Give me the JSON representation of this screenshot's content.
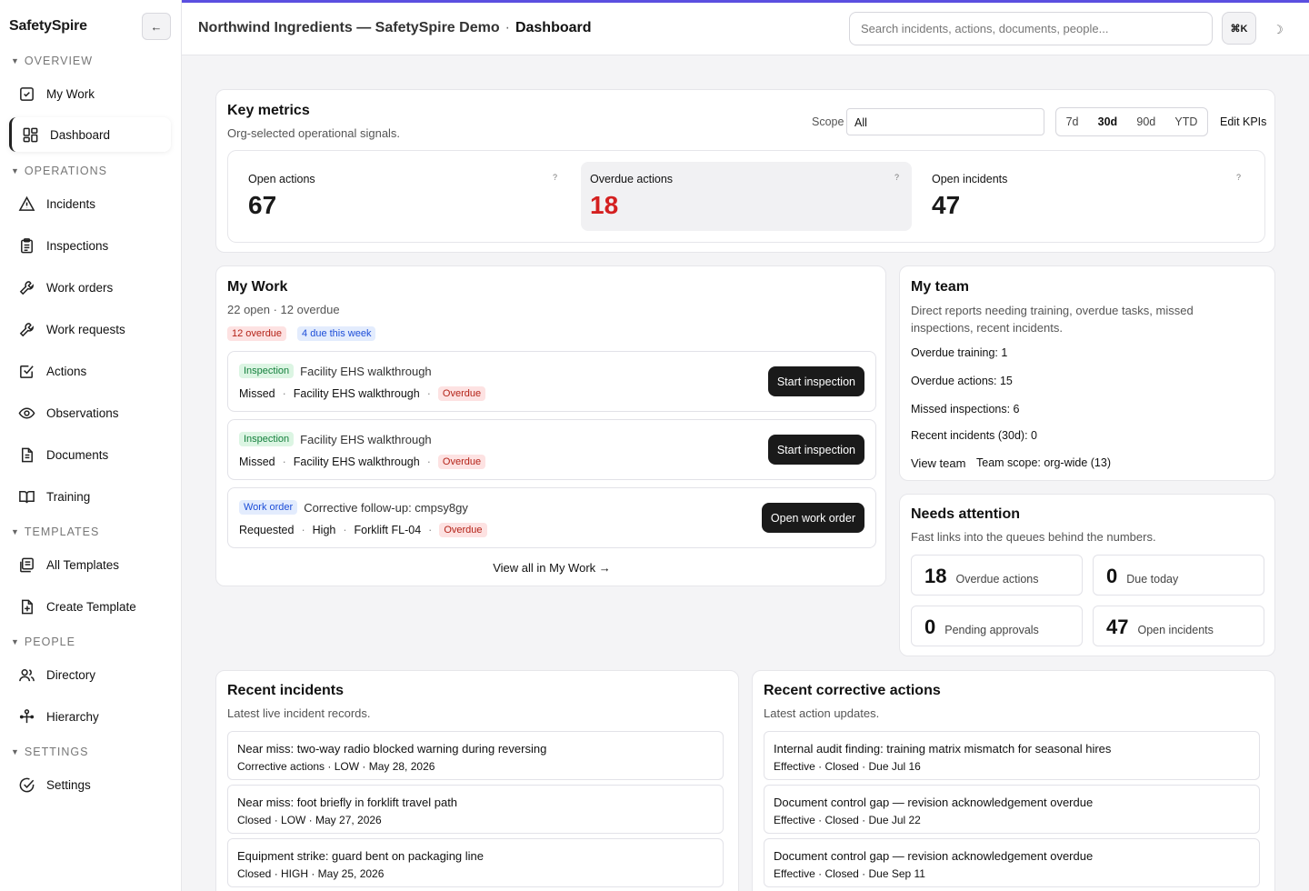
{
  "sidebar": {
    "brand": "SafetySpire",
    "collapse_icon": "←",
    "sections": [
      {
        "label": "OVERVIEW"
      },
      {
        "label": "OPERATIONS"
      },
      {
        "label": "TEMPLATES"
      },
      {
        "label": "PEOPLE"
      },
      {
        "label": "SETTINGS"
      }
    ],
    "items": [
      {
        "label": "My Work",
        "icon": "checkbox-icon"
      },
      {
        "label": "Dashboard",
        "icon": "grid-icon"
      },
      {
        "label": "Incidents",
        "icon": "warning-icon"
      },
      {
        "label": "Inspections",
        "icon": "clipboard-icon"
      },
      {
        "label": "Work orders",
        "icon": "wrench-icon"
      },
      {
        "label": "Work requests",
        "icon": "wrench-icon"
      },
      {
        "label": "Actions",
        "icon": "checkbox-icon"
      },
      {
        "label": "Observations",
        "icon": "eye-icon"
      },
      {
        "label": "Documents",
        "icon": "document-icon"
      },
      {
        "label": "Training",
        "icon": "book-icon"
      },
      {
        "label": "All Templates",
        "icon": "templates-icon"
      },
      {
        "label": "Create Template",
        "icon": "file-plus-icon"
      },
      {
        "label": "Directory",
        "icon": "users-icon"
      },
      {
        "label": "Hierarchy",
        "icon": "hierarchy-icon"
      },
      {
        "label": "Settings",
        "icon": "check-circle-icon"
      }
    ]
  },
  "header": {
    "org": "Northwind Ingredients — SafetySpire Demo",
    "separator": "·",
    "page": "Dashboard",
    "search_placeholder": "Search incidents, actions, documents, people...",
    "shortcut": "⌘K",
    "theme_icon": "☽"
  },
  "key_metrics": {
    "title": "Key metrics",
    "subtitle": "Org-selected operational signals.",
    "scope_label": "Scope",
    "scope_value": "All",
    "ranges": [
      "7d",
      "30d",
      "90d",
      "YTD"
    ],
    "selected_range": "30d",
    "edit_label": "Edit KPIs",
    "metrics": [
      {
        "label": "Open actions",
        "value": "67",
        "help": "?"
      },
      {
        "label": "Overdue actions",
        "value": "18",
        "help": "?"
      },
      {
        "label": "Open incidents",
        "value": "47",
        "help": "?"
      }
    ],
    "overdue_color": "#d42020"
  },
  "my_work": {
    "title": "My Work",
    "summary": "22 open · 12 overdue",
    "badges": [
      "12 overdue",
      "4 due this week"
    ],
    "items": [
      {
        "type": "Inspection",
        "title": "Facility EHS walkthrough",
        "meta": [
          "Missed",
          "Facility EHS walkthrough"
        ],
        "status": "Overdue",
        "button": "Start inspection"
      },
      {
        "type": "Inspection",
        "title": "Facility EHS walkthrough",
        "meta": [
          "Missed",
          "Facility EHS walkthrough"
        ],
        "status": "Overdue",
        "button": "Start inspection"
      },
      {
        "type": "Work order",
        "title": "Corrective follow-up: cmpsy8gy",
        "meta": [
          "Requested",
          "High",
          "Forklift FL-04"
        ],
        "status": "Overdue",
        "button": "Open work order"
      }
    ],
    "view_all": "View all in My Work →"
  },
  "my_team": {
    "title": "My team",
    "subtitle": "Direct reports needing training, overdue tasks, missed inspections, recent incidents.",
    "lines": [
      "Overdue training: 1",
      "Overdue actions: 15",
      "Missed inspections: 6",
      "Recent incidents (30d): 0"
    ],
    "view_team": "View team",
    "scope": "Team scope: org-wide (13)"
  },
  "needs_attention": {
    "title": "Needs attention",
    "subtitle": "Fast links into the queues behind the numbers.",
    "boxes": [
      {
        "n": "18",
        "t": "Overdue actions"
      },
      {
        "n": "0",
        "t": "Due today"
      },
      {
        "n": "0",
        "t": "Pending approvals"
      },
      {
        "n": "47",
        "t": "Open incidents"
      }
    ]
  },
  "recent_incidents": {
    "title": "Recent incidents",
    "subtitle": "Latest live incident records.",
    "items": [
      {
        "title": "Near miss: two-way radio blocked warning during reversing",
        "meta": "Corrective actions · LOW · May 28, 2026"
      },
      {
        "title": "Near miss: foot briefly in forklift travel path",
        "meta": "Closed · LOW · May 27, 2026"
      },
      {
        "title": "Equipment strike: guard bent on packaging line",
        "meta": "Closed · HIGH · May 25, 2026"
      }
    ]
  },
  "recent_actions": {
    "title": "Recent corrective actions",
    "subtitle": "Latest action updates.",
    "items": [
      {
        "title": "Internal audit finding: training matrix mismatch for seasonal hires",
        "meta": "Effective · Closed · Due Jul 16"
      },
      {
        "title": "Document control gap — revision acknowledgement overdue",
        "meta": "Effective · Closed · Due Jul 22"
      },
      {
        "title": "Document control gap — revision acknowledgement overdue",
        "meta": "Effective · Closed · Due Sep 11"
      }
    ]
  }
}
